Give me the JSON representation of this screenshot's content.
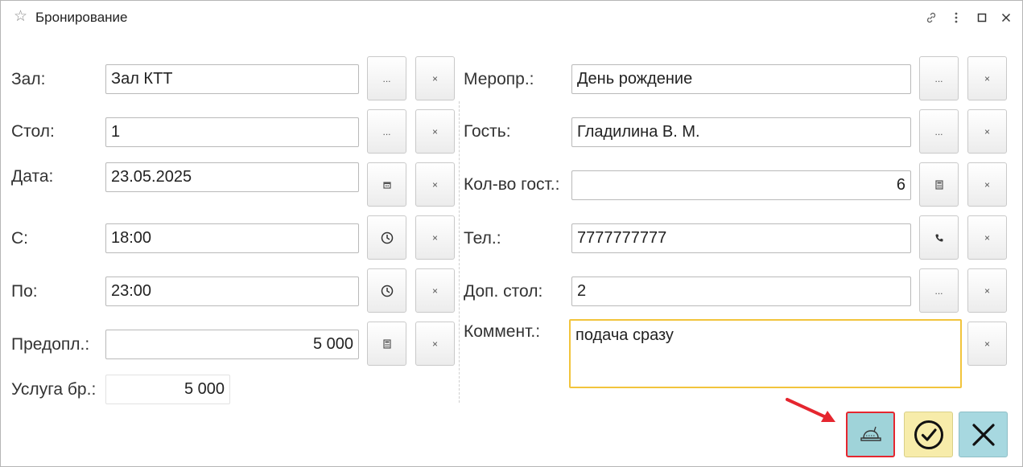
{
  "window": {
    "title": "Бронирование",
    "title_icon": "star-icon"
  },
  "titlebar_icons": [
    "link-icon",
    "more-vertical-icon",
    "maximize-icon",
    "close-icon"
  ],
  "left": {
    "hall": {
      "label": "Зал:",
      "value": "Зал КТТ"
    },
    "table": {
      "label": "Стол:",
      "value": "1"
    },
    "date": {
      "label": "Дата:",
      "value": "23.05.2025"
    },
    "from": {
      "label": "С:",
      "value": "18:00"
    },
    "to": {
      "label": "По:",
      "value": "23:00"
    },
    "prepay": {
      "label": "Предопл.:",
      "value": "5 000"
    },
    "service": {
      "label": "Услуга бр.:",
      "value": "5 000"
    }
  },
  "right": {
    "event": {
      "label": "Меропр.:",
      "value": "День рождение"
    },
    "guest": {
      "label": "Гость:",
      "value": "Гладилина В. М."
    },
    "guests_count": {
      "label": "Кол-во гост.:",
      "value": "6"
    },
    "phone": {
      "label": "Тел.:",
      "value": "7777777777"
    },
    "extra_table": {
      "label": "Доп. стол:",
      "value": "2"
    },
    "comment": {
      "label": "Коммент.:",
      "value": "подача сразу"
    }
  },
  "buttons": {
    "select_symbol": "...",
    "clear_symbol": "×"
  },
  "footer": {
    "menu_icon": "food-cloche-icon",
    "ok_icon": "checkmark-circle-icon",
    "close_icon": "close-x-icon"
  },
  "colors": {
    "highlight_border": "#e5262f",
    "ok_bg": "#f7ecaa",
    "comment_border": "#f2c43c",
    "arrow": "#e5262f"
  }
}
